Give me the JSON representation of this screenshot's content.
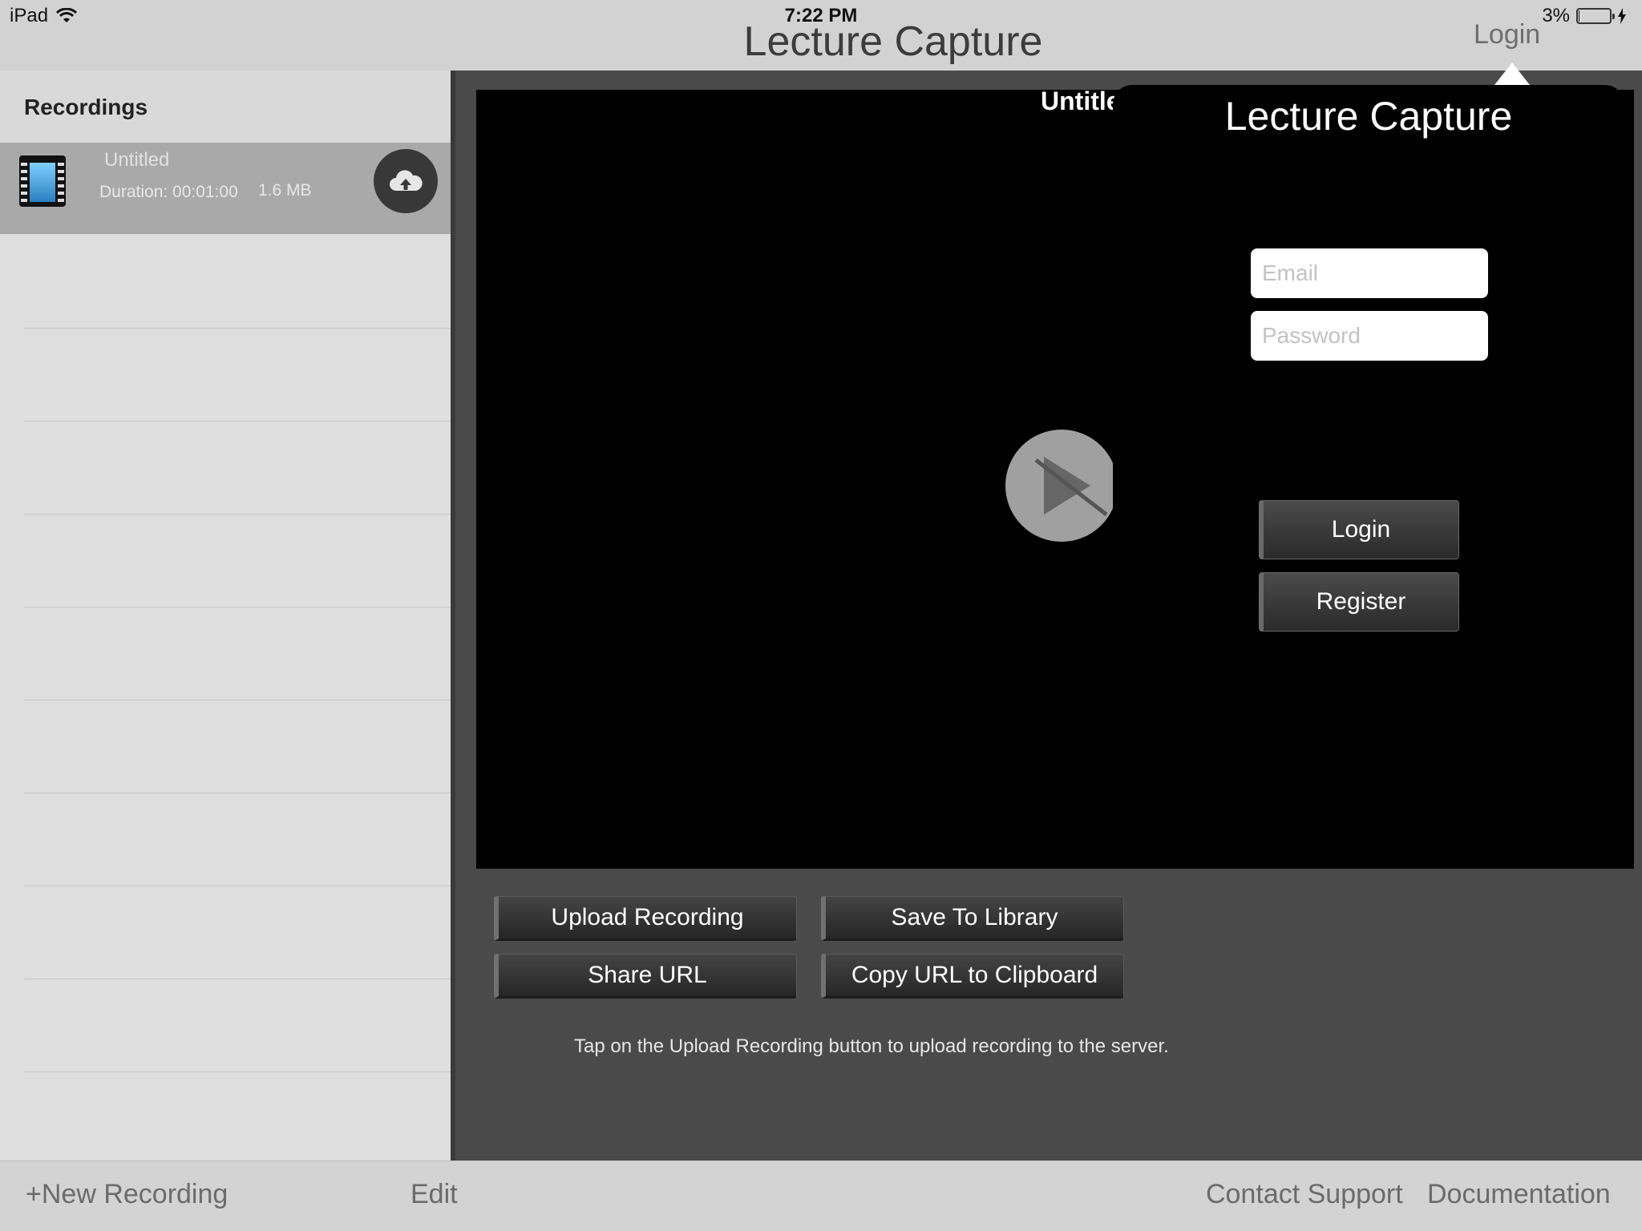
{
  "status": {
    "device": "iPad",
    "time": "7:22 PM",
    "battery": "3%"
  },
  "nav": {
    "title": "Lecture Capture",
    "login": "Login"
  },
  "sidebar": {
    "title": "Recordings",
    "recordings": [
      {
        "title": "Untitled",
        "duration": "Duration: 00:01:00",
        "size": "1.6 MB"
      }
    ]
  },
  "player": {
    "title": "Untitled"
  },
  "login_popover": {
    "title": "Lecture Capture",
    "email_placeholder": "Email",
    "password_placeholder": "Password",
    "login_label": "Login",
    "register_label": "Register"
  },
  "actions": {
    "upload_recording": "Upload Recording",
    "save_to_library": "Save To Library",
    "share_url": "Share URL",
    "copy_url": "Copy URL to Clipboard",
    "hint": "Tap on the Upload Recording button to upload recording to the server."
  },
  "bottom_bar": {
    "new_recording": "+New Recording",
    "edit": "Edit",
    "contact_support": "Contact Support",
    "documentation": "Documentation"
  }
}
